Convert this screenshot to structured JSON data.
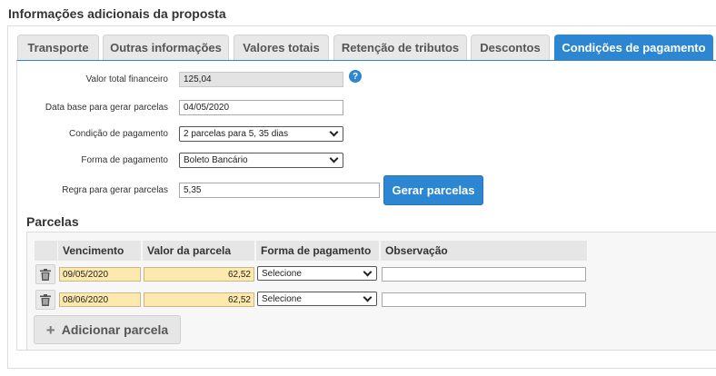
{
  "page": {
    "title": "Informações adicionais da proposta"
  },
  "tabs": [
    {
      "label": "Transporte",
      "active": false
    },
    {
      "label": "Outras informações",
      "active": false
    },
    {
      "label": "Valores totais",
      "active": false
    },
    {
      "label": "Retenção de tributos",
      "active": false
    },
    {
      "label": "Descontos",
      "active": false
    },
    {
      "label": "Condições de pagamento",
      "active": true
    }
  ],
  "form": {
    "valor_total": {
      "label": "Valor total financeiro",
      "value": "125,04"
    },
    "data_base": {
      "label": "Data base para gerar parcelas",
      "value": "04/05/2020"
    },
    "condicao": {
      "label": "Condição de pagamento",
      "value": "2 parcelas para 5, 35 dias"
    },
    "forma": {
      "label": "Forma de pagamento",
      "value": "Boleto Bancário"
    },
    "regra": {
      "label": "Regra para gerar parcelas",
      "value": "5,35"
    },
    "help_icon": "?",
    "gerar_button": "Gerar parcelas"
  },
  "parcelas": {
    "title": "Parcelas",
    "columns": [
      "Vencimento",
      "Valor da parcela",
      "Forma de pagamento",
      "Observação"
    ],
    "rows": [
      {
        "vencimento": "09/05/2020",
        "valor": "62,52",
        "forma": "Selecione",
        "observacao": ""
      },
      {
        "vencimento": "08/06/2020",
        "valor": "62,52",
        "forma": "Selecione",
        "observacao": ""
      }
    ],
    "add_button": "Adicionar parcela",
    "add_icon": "+"
  },
  "colors": {
    "accent": "#2d86d1",
    "highlight": "#fde9ae",
    "tab_bg": "#e8e8e8"
  }
}
